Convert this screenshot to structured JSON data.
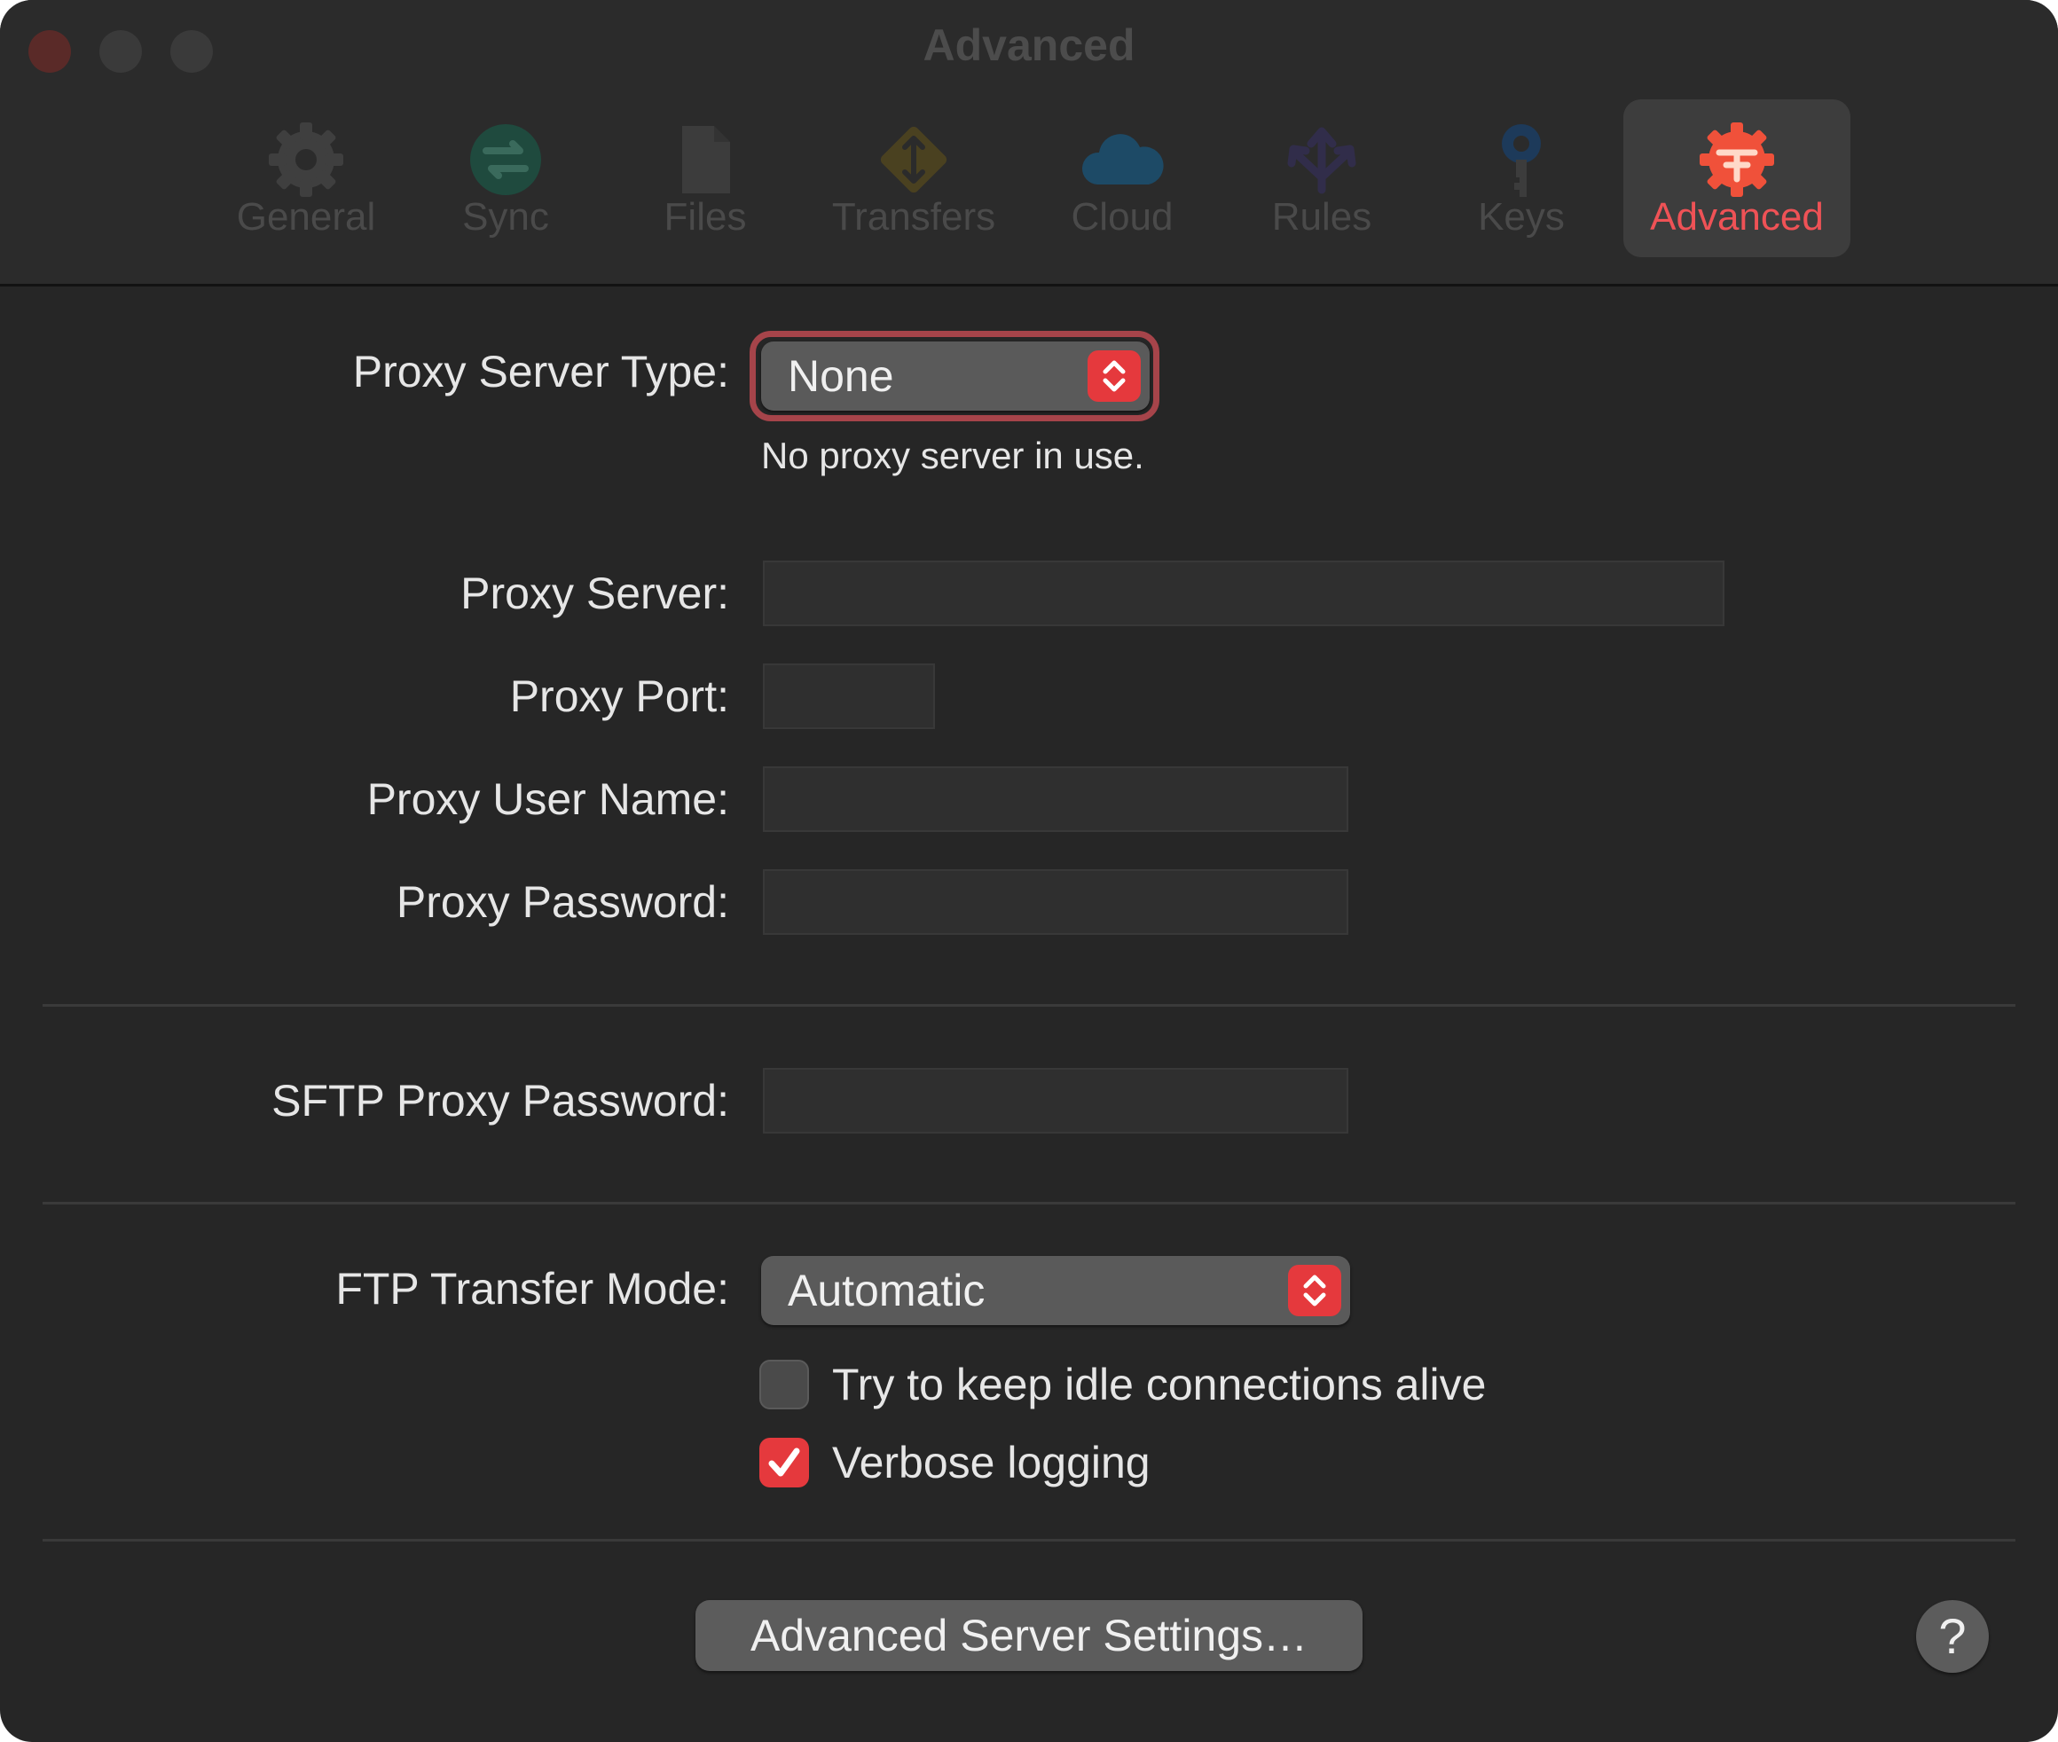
{
  "window": {
    "title": "Advanced"
  },
  "toolbar": {
    "tabs": [
      {
        "label": "General",
        "icon": "gear-icon",
        "active": false
      },
      {
        "label": "Sync",
        "icon": "sync-arrows-icon",
        "active": false
      },
      {
        "label": "Files",
        "icon": "document-icon",
        "active": false
      },
      {
        "label": "Transfers",
        "icon": "transfer-diamond-icon",
        "active": false
      },
      {
        "label": "Cloud",
        "icon": "cloud-icon",
        "active": false
      },
      {
        "label": "Rules",
        "icon": "branch-arrows-icon",
        "active": false
      },
      {
        "label": "Keys",
        "icon": "key-icon",
        "active": false
      },
      {
        "label": "Advanced",
        "icon": "advanced-gear-icon",
        "active": true
      }
    ]
  },
  "proxy": {
    "server_type_label": "Proxy Server Type:",
    "server_type_value": "None",
    "server_type_hint": "No proxy server in use.",
    "server_label": "Proxy Server:",
    "server_value": "",
    "port_label": "Proxy Port:",
    "port_value": "",
    "username_label": "Proxy User Name:",
    "username_value": "",
    "password_label": "Proxy Password:",
    "password_value": ""
  },
  "sftp": {
    "password_label": "SFTP Proxy Password:",
    "password_value": ""
  },
  "ftp": {
    "mode_label": "FTP Transfer Mode:",
    "mode_value": "Automatic",
    "keep_alive_label": "Try to keep idle connections alive",
    "keep_alive_checked": false,
    "verbose_label": "Verbose logging",
    "verbose_checked": true
  },
  "footer": {
    "advanced_button": "Advanced Server Settings…",
    "help_button": "?"
  },
  "colors": {
    "accent": "#e5393d",
    "window_bg": "#262626",
    "active_tab_label": "#ef5256"
  }
}
